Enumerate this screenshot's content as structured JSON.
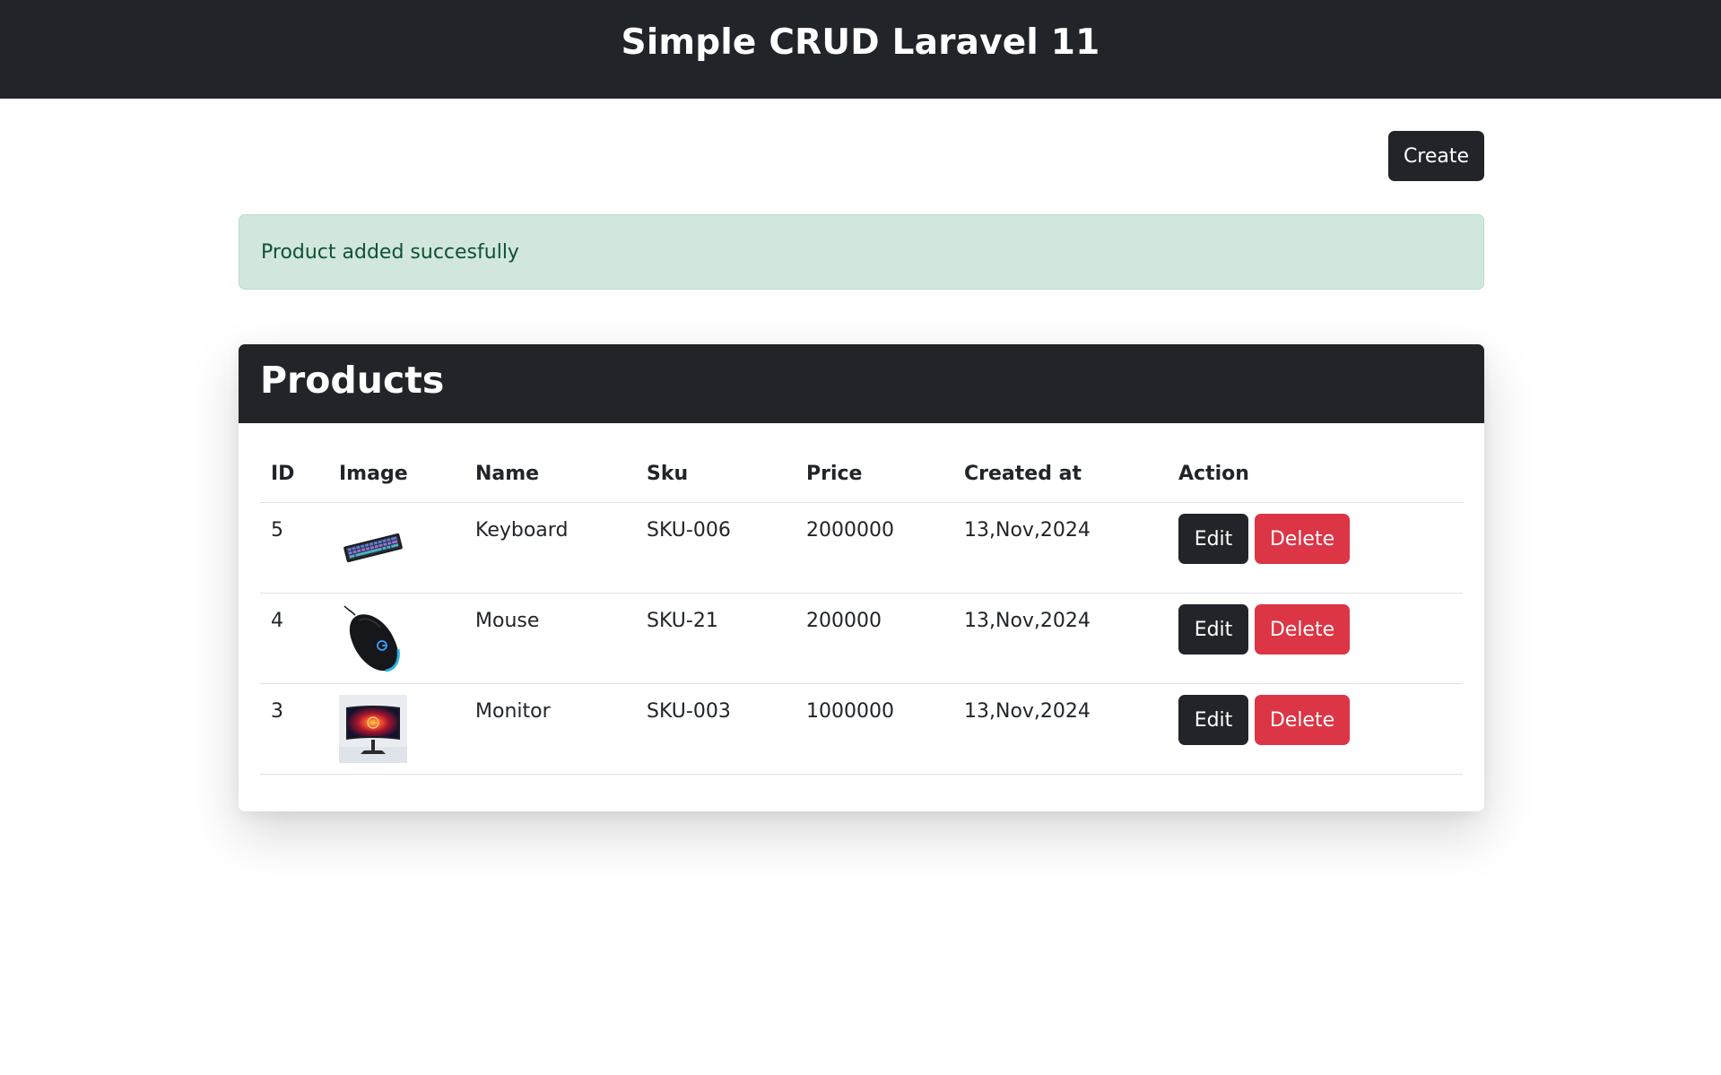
{
  "header": {
    "title": "Simple CRUD Laravel 11"
  },
  "toolbar": {
    "create_label": "Create"
  },
  "alert": {
    "message": "Product added succesfully",
    "color": "#d1e7dd"
  },
  "products": {
    "title": "Products",
    "columns": [
      "ID",
      "Image",
      "Name",
      "Sku",
      "Price",
      "Created at",
      "Action"
    ],
    "rows": [
      {
        "id": "5",
        "image": "keyboard-image",
        "name": "Keyboard",
        "sku": "SKU-006",
        "price": "2000000",
        "created_at": "13,Nov,2024",
        "edit_label": "Edit",
        "delete_label": "Delete"
      },
      {
        "id": "4",
        "image": "mouse-image",
        "name": "Mouse",
        "sku": "SKU-21",
        "price": "200000",
        "created_at": "13,Nov,2024",
        "edit_label": "Edit",
        "delete_label": "Delete"
      },
      {
        "id": "3",
        "image": "monitor-image",
        "name": "Monitor",
        "sku": "SKU-003",
        "price": "1000000",
        "created_at": "13,Nov,2024",
        "edit_label": "Edit",
        "delete_label": "Delete"
      }
    ]
  },
  "colors": {
    "dark": "#212529",
    "danger": "#dc3545",
    "success_text": "#0f5132"
  }
}
